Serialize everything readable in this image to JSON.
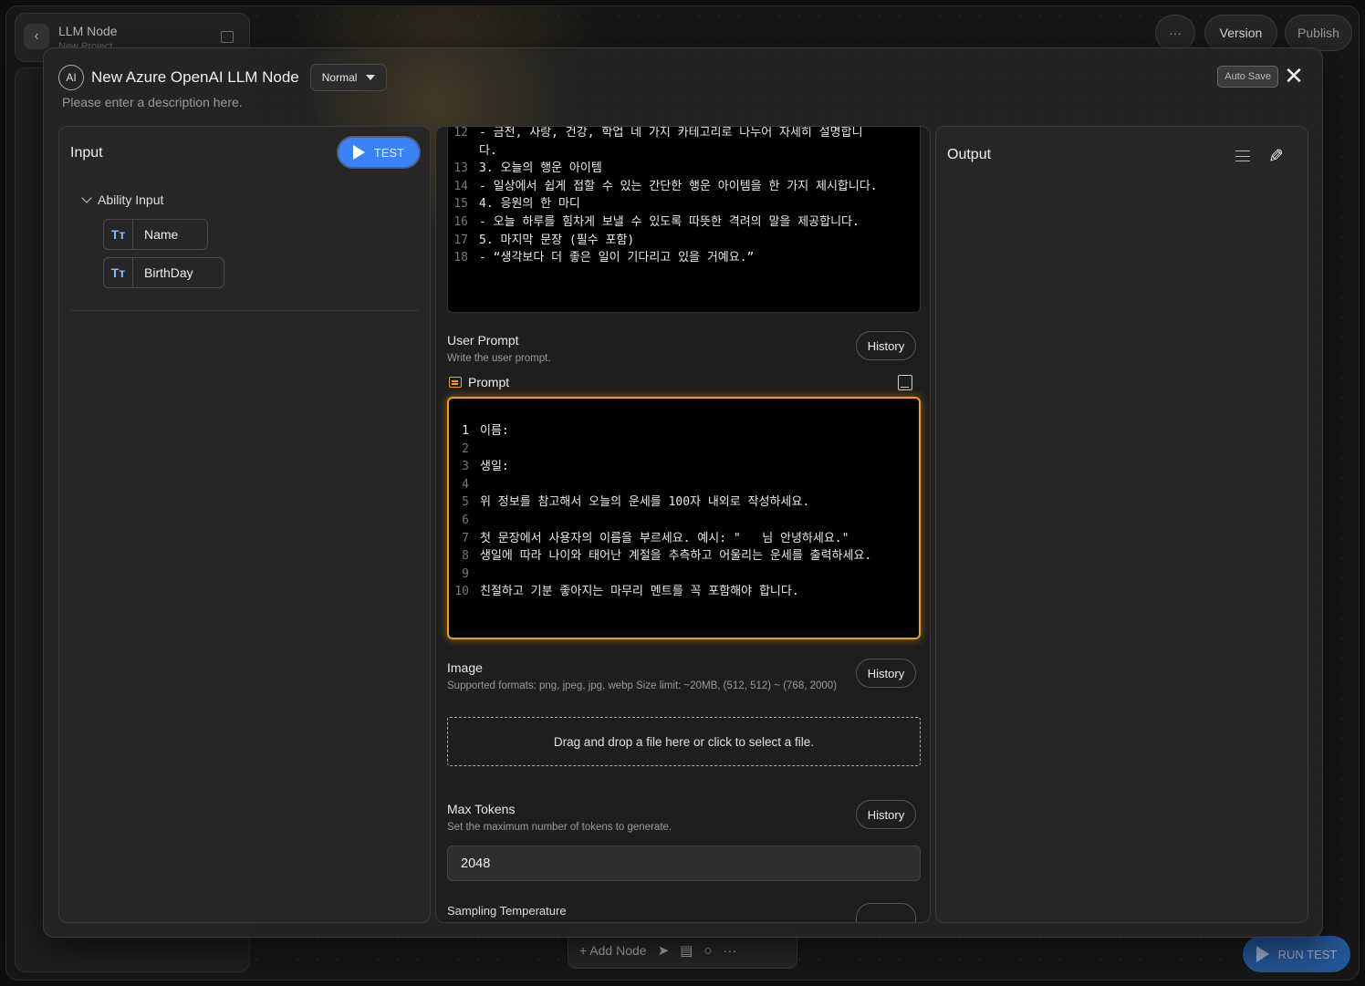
{
  "app": {
    "title": "LLM Node",
    "subtitle": "New Project",
    "more_label": "···",
    "version_label": "Version",
    "publish_label": "Publish"
  },
  "bottombar": {
    "add_node_label": "+ Add Node",
    "run_test_label": "RUN TEST"
  },
  "modal": {
    "badge": "AI",
    "title": "New Azure OpenAI LLM Node",
    "mode": "Normal",
    "description": "Please enter a description here.",
    "autosave_label": "Auto Save",
    "close_label": "✕"
  },
  "input_panel": {
    "title": "Input",
    "test_label": "TEST",
    "group_label": "Ability Input",
    "fields": [
      {
        "icon": "Tт",
        "label": "Name"
      },
      {
        "icon": "Tт",
        "label": "BirthDay"
      }
    ]
  },
  "system_prompt": {
    "lines": [
      {
        "n": "12",
        "text": "- 금전, 사랑, 건강, 학업 네 가지 카테고리로 나누어 자세히 설명합니"
      },
      {
        "n": "",
        "text": "다."
      },
      {
        "n": "13",
        "text": "3. 오늘의 행운 아이템"
      },
      {
        "n": "14",
        "text": "- 일상에서 쉽게 접할 수 있는 간단한 행운 아이템을 한 가지 제시합니다."
      },
      {
        "n": "15",
        "text": "4. 응원의 한 마디"
      },
      {
        "n": "16",
        "text": "- 오늘 하루를 힘차게 보낼 수 있도록 따뜻한 격려의 말을 제공합니다."
      },
      {
        "n": "17",
        "text": "5. 마지막 문장 (필수 포함)"
      },
      {
        "n": "18",
        "text": "- “생각보다 더 좋은 일이 기다리고 있을 거예요.”"
      }
    ]
  },
  "user_prompt": {
    "label": "User Prompt",
    "description": "Write the user prompt.",
    "history_label": "History",
    "prompt_label": "Prompt",
    "lines": [
      {
        "n": "1",
        "text": "이름: "
      },
      {
        "n": "2",
        "text": ""
      },
      {
        "n": "3",
        "text": "생일: "
      },
      {
        "n": "4",
        "text": ""
      },
      {
        "n": "5",
        "text": "위 정보를 참고해서 오늘의 운세를 100자 내외로 작성하세요."
      },
      {
        "n": "6",
        "text": ""
      },
      {
        "n": "7",
        "text": "첫 문장에서 사용자의 이름을 부르세요. 예시: \"   님 안녕하세요.\""
      },
      {
        "n": "8",
        "text": "생일에 따라 나이와 태어난 계절을 추측하고 어울리는 운세를 출력하세요."
      },
      {
        "n": "9",
        "text": ""
      },
      {
        "n": "10",
        "text": "친절하고 기분 좋아지는 마무리 멘트를 꼭 포함해야 합니다."
      }
    ]
  },
  "image": {
    "label": "Image",
    "description": "Supported formats: png, jpeg, jpg, webp Size limit: ~20MB, (512, 512) ~ (768, 2000)",
    "history_label": "History",
    "dropzone_label": "Drag and drop a file here or click to select a file."
  },
  "max_tokens": {
    "label": "Max Tokens",
    "description": "Set the maximum number of tokens to generate.",
    "history_label": "History",
    "value": "2048"
  },
  "temperature": {
    "label": "Sampling Temperature"
  },
  "output_panel": {
    "title": "Output"
  }
}
